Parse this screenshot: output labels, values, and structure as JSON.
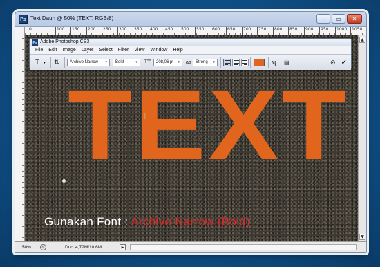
{
  "document": {
    "title": "Text Daun @ 50% (TEXT, RGB/8)",
    "ruler_ticks": [
      "0",
      "100",
      "150",
      "200",
      "250",
      "300",
      "350",
      "400",
      "450",
      "500",
      "550",
      "600",
      "650",
      "700",
      "750",
      "800",
      "850",
      "900",
      "950",
      "1000",
      "1050"
    ],
    "canvas_text": "TEXT",
    "text_color": "#e2651e",
    "caption_prefix": "Gunakan Font :",
    "caption_font": "Archivo Narrow (Bold)",
    "caption_font_color": "#e02828",
    "status": {
      "zoom": "50%",
      "doc_info": "Doc: 4,72M/10,6M"
    }
  },
  "window_buttons": {
    "minimize": "–",
    "maximize": "▭",
    "close": "✕"
  },
  "app": {
    "title": "Adobe Photoshop CS3",
    "icon_label": "Ps",
    "menu": [
      "File",
      "Edit",
      "Image",
      "Layer",
      "Select",
      "Filter",
      "View",
      "Window",
      "Help"
    ]
  },
  "options_bar": {
    "tool_icon": "T",
    "font_family": "Archivo Narrow",
    "font_style": "Bold",
    "font_size": "208,06 pt",
    "antialias_label": "aa",
    "antialias": "Strong",
    "text_color": "#e2651e",
    "icons": [
      "text-tool-icon",
      "orientation-icon",
      "font-size-icon",
      "antialias-icon",
      "align-left-icon",
      "align-center-icon",
      "align-right-icon",
      "warp-text-icon",
      "character-panel-icon",
      "cancel-icon",
      "commit-icon"
    ]
  }
}
